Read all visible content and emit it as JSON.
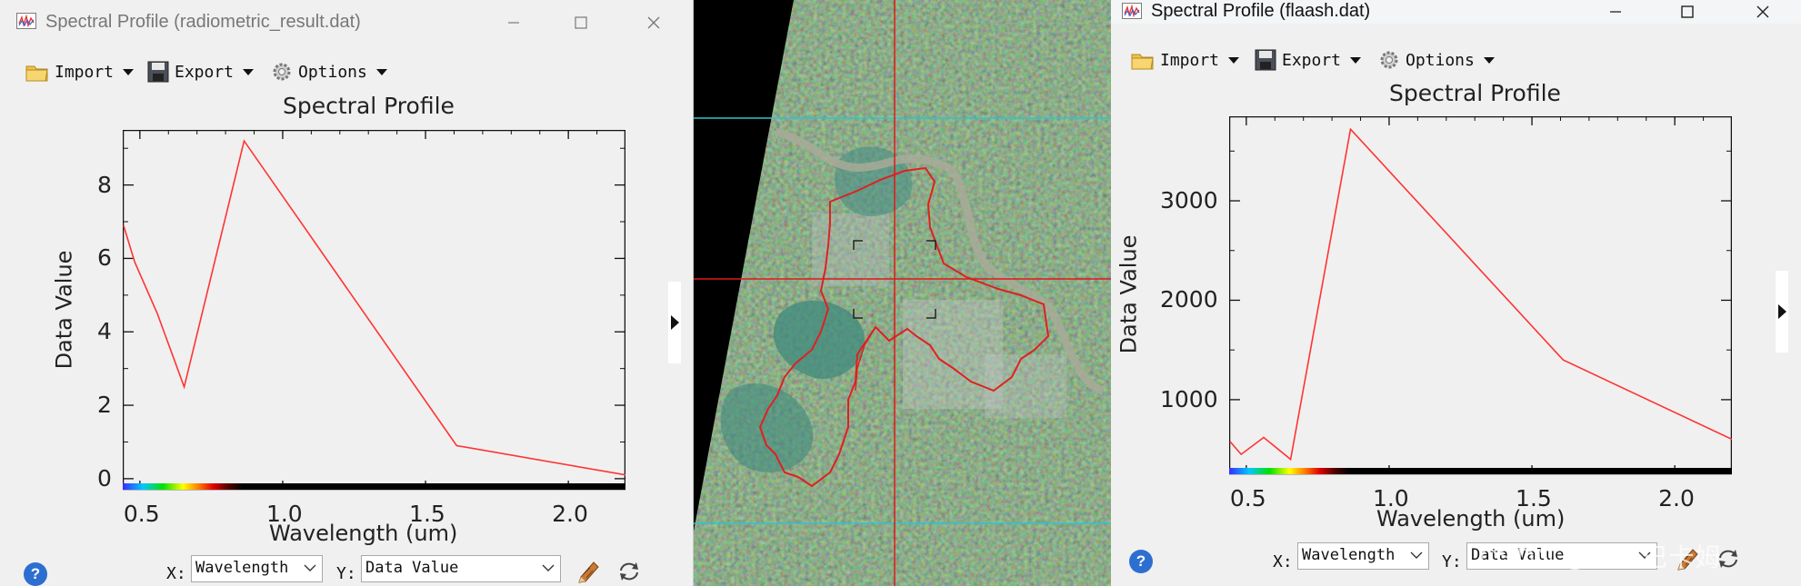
{
  "window1": {
    "title": "Spectral Profile (radiometric_result.dat)",
    "toolbar": {
      "import_label": "Import",
      "export_label": "Export",
      "options_label": "Options"
    },
    "x_select_label": "X:",
    "x_select_value": "Wavelength",
    "y_select_label": "Y:",
    "y_select_value": "Data Value",
    "help_label": "?"
  },
  "window2": {
    "title": "Spectral Profile (flaash.dat)",
    "toolbar": {
      "import_label": "Import",
      "export_label": "Export",
      "options_label": "Options"
    },
    "x_select_label": "X:",
    "x_select_value": "Wavelength",
    "y_select_label": "Y:",
    "y_select_value": "Data Value",
    "help_label": "?"
  },
  "watermark": "CSDN @玛卡巴卡姆",
  "colors": {
    "line": "#ff3333",
    "crosshair_red": "#e01818",
    "crosshair_cyan": "#2fc4cc",
    "help": "#2d6fd0"
  },
  "chart_data": [
    {
      "type": "line",
      "title": "Spectral Profile",
      "xlabel": "Wavelength (um)",
      "ylabel": "Data Value",
      "xlim": [
        0.44,
        2.2
      ],
      "ylim": [
        -0.3,
        9.5
      ],
      "xticks": [
        "0.5",
        "1.0",
        "1.5",
        "2.0"
      ],
      "xtick_values": [
        0.5,
        1.0,
        1.5,
        2.0
      ],
      "yticks": [
        "0",
        "2",
        "4",
        "6",
        "8"
      ],
      "ytick_values": [
        0,
        2,
        4,
        6,
        8
      ],
      "series": [
        {
          "x": [
            0.443,
            0.482,
            0.561,
            0.655,
            0.865,
            1.609,
            2.201
          ],
          "y": [
            6.9,
            5.9,
            4.5,
            2.5,
            9.2,
            0.9,
            0.1
          ]
        }
      ]
    },
    {
      "type": "line",
      "title": "Spectral Profile",
      "xlabel": "Wavelength (um)",
      "ylabel": "Data Value",
      "xlim": [
        0.44,
        2.2
      ],
      "ylim": [
        250,
        3850
      ],
      "xticks": [
        "0.5",
        "1.0",
        "1.5",
        "2.0"
      ],
      "xtick_values": [
        0.5,
        1.0,
        1.5,
        2.0
      ],
      "yticks": [
        "1000",
        "2000",
        "3000"
      ],
      "ytick_values": [
        1000,
        2000,
        3000
      ],
      "series": [
        {
          "x": [
            0.443,
            0.482,
            0.561,
            0.655,
            0.865,
            1.609,
            2.201
          ],
          "y": [
            580,
            450,
            620,
            400,
            3720,
            1400,
            600
          ]
        }
      ]
    }
  ]
}
